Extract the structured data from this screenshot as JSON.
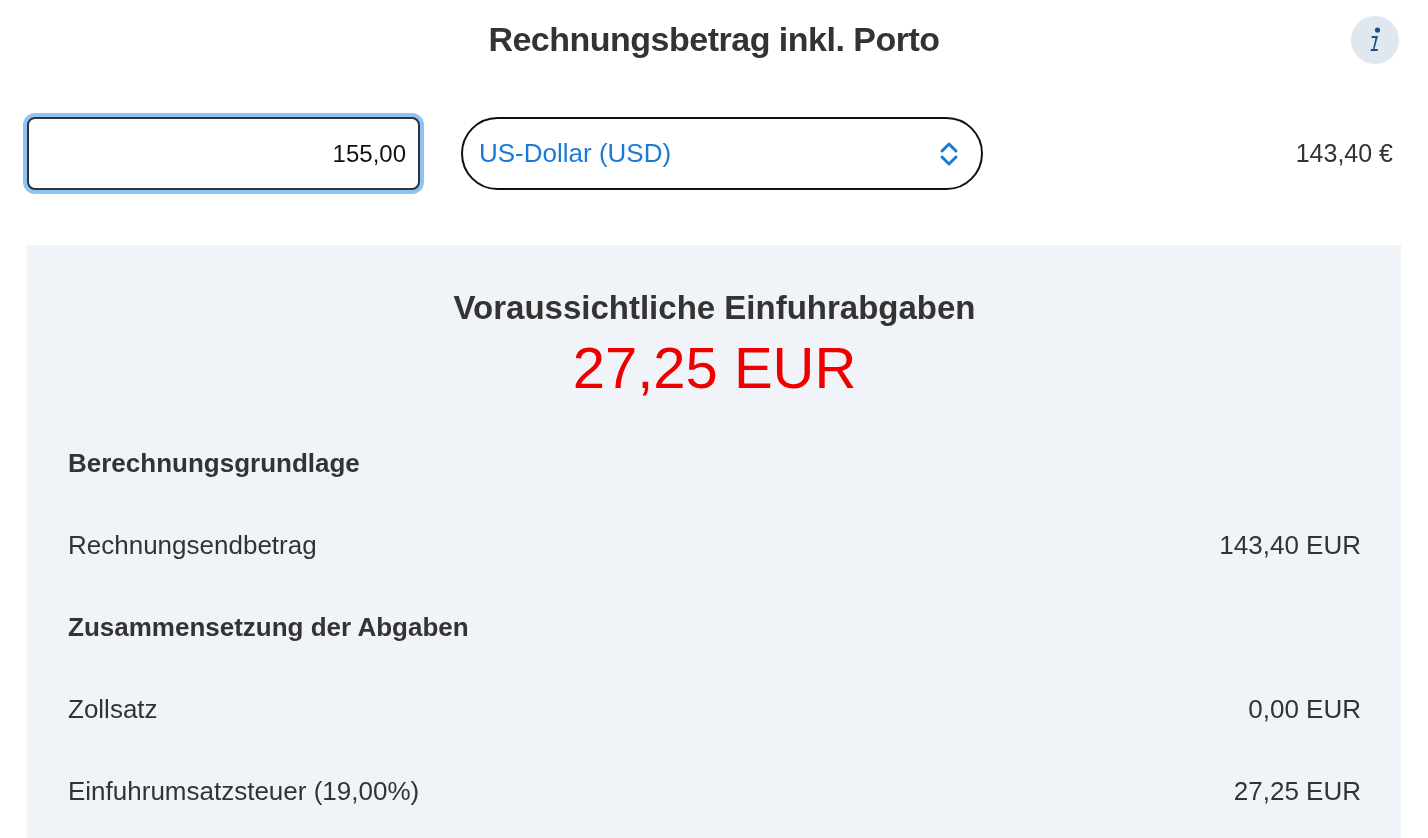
{
  "title": "Rechnungsbetrag inkl. Porto",
  "amount_field": {
    "value": "155,00",
    "focused": true
  },
  "currency_select": {
    "value": "US-Dollar (USD)"
  },
  "converted": "143,40 €",
  "result": {
    "heading": "Voraussichtliche Einfuhrabgaben",
    "total": "27,25 EUR",
    "lines": [
      {
        "kind": "section",
        "label": "Berechnungsgrundlage"
      },
      {
        "kind": "row",
        "label": "Rechnungsendbetrag",
        "value": "143,40 EUR"
      },
      {
        "kind": "section",
        "label": "Zusammensetzung der Abgaben"
      },
      {
        "kind": "row",
        "label": "Zollsatz",
        "value": "0,00 EUR"
      },
      {
        "kind": "row",
        "label": "Einfuhrumsatzsteuer (19,00%)",
        "value": "27,25 EUR"
      }
    ]
  }
}
